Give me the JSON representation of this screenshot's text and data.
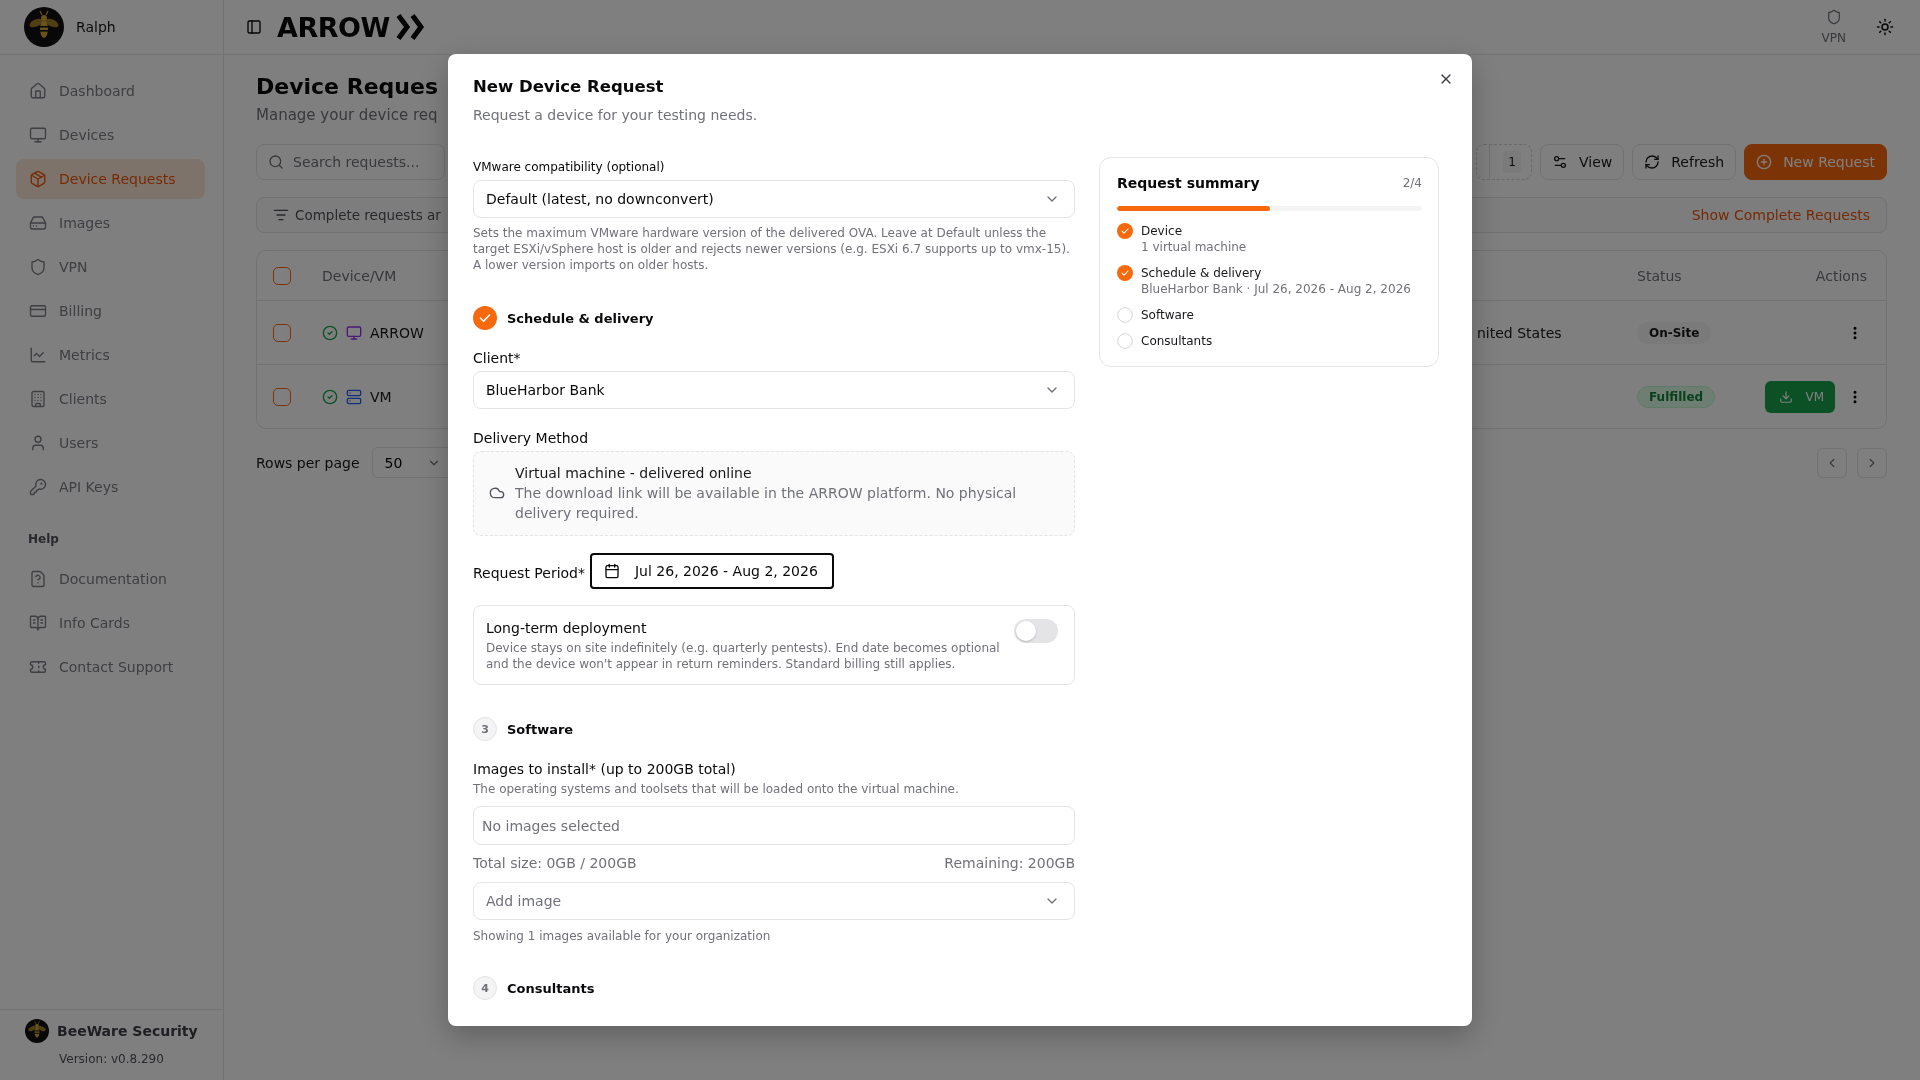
{
  "sidebar": {
    "user": {
      "name": "Ralph"
    },
    "nav": [
      {
        "label": "Dashboard",
        "selected": false
      },
      {
        "label": "Devices",
        "selected": false
      },
      {
        "label": "Device Requests",
        "selected": true
      },
      {
        "label": "Images",
        "selected": false
      },
      {
        "label": "VPN",
        "selected": false
      },
      {
        "label": "Billing",
        "selected": false
      },
      {
        "label": "Metrics",
        "selected": false
      },
      {
        "label": "Clients",
        "selected": false
      },
      {
        "label": "Users",
        "selected": false
      },
      {
        "label": "API Keys",
        "selected": false
      }
    ],
    "help": {
      "heading": "Help",
      "items": [
        {
          "label": "Documentation",
          "selected": false
        },
        {
          "label": "Info Cards",
          "selected": false
        },
        {
          "label": "Contact Support",
          "selected": false
        }
      ]
    },
    "footer": {
      "organization": "BeeWare Security",
      "version": "Version: v0.8.290"
    }
  },
  "topbar": {
    "logo": "ARROW",
    "vpn": "VPN"
  },
  "page": {
    "title": "Device Reques",
    "subtitle": "Manage your device req",
    "search": {
      "placeholder": "Search requests..."
    },
    "toolbar": {
      "filter_count": "1",
      "buttons": [
        {
          "label": "View",
          "kind": "view"
        },
        {
          "label": "Refresh",
          "kind": "refresh"
        },
        {
          "label": "New Request",
          "kind": "new"
        }
      ]
    },
    "filter_bar": {
      "text": "Complete requests ar",
      "link": "Show Complete Requests"
    },
    "table": {
      "select_all": false,
      "headers": {
        "device": "Device/VM",
        "status": "Status",
        "actions": "Actions"
      },
      "rows": [
        {
          "checked": false,
          "kind": "device",
          "name": "ARROW",
          "location": "nited States",
          "status": {
            "label": "On-Site",
            "kind": "neutral"
          }
        },
        {
          "checked": false,
          "kind": "vm",
          "name": "VM",
          "status": {
            "label": "Fulfilled",
            "kind": "success"
          },
          "download": "VM"
        }
      ]
    },
    "pagination": {
      "rows_label": "Rows per page",
      "rows_value": "50"
    }
  },
  "dialog": {
    "title": "New Device Request",
    "description": "Request a device for your testing needs.",
    "vmware": {
      "label": "VMware compatibility (optional)",
      "value": "Default (latest, no downconvert)",
      "help": "Sets the maximum VMware hardware version of the delivered OVA. Leave at Default unless the target ESXi/vSphere host is older and rejects newer versions (e.g. ESXi 6.7 supports up to vmx-15). A lower version imports on older hosts."
    },
    "schedule": {
      "step": {
        "title": "Schedule & delivery",
        "done": true
      },
      "client": {
        "label": "Client*",
        "value": "BlueHarbor Bank"
      },
      "delivery": {
        "label": "Delivery Method",
        "title": "Virtual machine - delivered online",
        "description": "The download link will be available in the ARROW platform. No physical delivery required."
      },
      "period": {
        "label": "Request Period*",
        "value": "Jul 26, 2026 - Aug 2, 2026"
      },
      "long_term": {
        "title": "Long-term deployment",
        "description": "Device stays on site indefinitely (e.g. quarterly pentests). End date becomes optional and the device won't appear in return reminders. Standard billing still applies.",
        "on": false
      }
    },
    "software": {
      "step": {
        "number": "3",
        "title": "Software",
        "done": false
      },
      "images": {
        "label": "Images to install* (up to 200GB total)",
        "help": "The operating systems and toolsets that will be loaded onto the virtual machine.",
        "placeholder": "No images selected"
      },
      "total": "Total size: 0GB / 200GB",
      "remaining": "Remaining: 200GB",
      "add_image": {
        "placeholder": "Add image"
      },
      "note": "Showing 1 images available for your organization"
    },
    "consultants": {
      "step": {
        "number": "4",
        "title": "Consultants",
        "done": false
      }
    },
    "summary": {
      "title": "Request summary",
      "count": "2/4",
      "level": 0.5,
      "items": [
        {
          "title": "Device",
          "detail": "1 virtual machine",
          "done": true
        },
        {
          "title": "Schedule & delivery",
          "detail": "BlueHarbor Bank · Jul 26, 2026 - Aug 2, 2026",
          "done": true
        },
        {
          "title": "Software",
          "done": false
        },
        {
          "title": "Consultants",
          "done": false
        }
      ]
    }
  }
}
